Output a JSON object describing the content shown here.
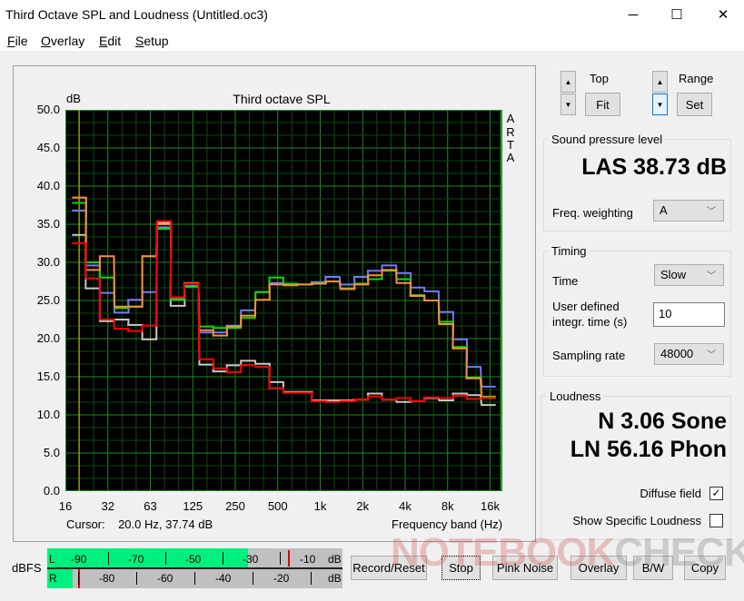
{
  "window": {
    "title": "Third Octave SPL and Loudness (Untitled.oc3)",
    "minimize": "─",
    "maximize": "☐",
    "close": "✕"
  },
  "menu": [
    {
      "first": "F",
      "rest": "ile"
    },
    {
      "first": "O",
      "rest": "verlay"
    },
    {
      "first": "E",
      "rest": "dit"
    },
    {
      "first": "S",
      "rest": "etup"
    }
  ],
  "chart_data": {
    "type": "line",
    "title": "Third octave SPL",
    "ylabel": "dB",
    "xlabel": "Frequency band (Hz)",
    "ylim": [
      0,
      50
    ],
    "yticks": [
      "50.0",
      "45.0",
      "40.0",
      "35.0",
      "30.0",
      "25.0",
      "20.0",
      "15.0",
      "10.0",
      "5.0",
      "0.0"
    ],
    "xticks": [
      "16",
      "32",
      "63",
      "125",
      "250",
      "500",
      "1k",
      "2k",
      "4k",
      "8k",
      "16k"
    ],
    "side_label": [
      "A",
      "R",
      "T",
      "A"
    ],
    "cursor_text": "Cursor:    20.0 Hz, 37.74 dB",
    "cursor_freq": 20,
    "bands_hz": [
      20,
      25,
      31.5,
      40,
      50,
      63,
      80,
      100,
      125,
      160,
      200,
      250,
      315,
      400,
      500,
      630,
      800,
      1000,
      1250,
      1600,
      2000,
      2500,
      3150,
      4000,
      5000,
      6300,
      8000,
      10000,
      12500,
      16000
    ],
    "series": [
      {
        "name": "gray",
        "color": "#c8c8c8",
        "values": [
          33.6,
          26.6,
          22.3,
          22.5,
          21.8,
          19.9,
          35.2,
          24.3,
          27.2,
          16.6,
          15.7,
          16.5,
          17.1,
          16.7,
          14.3,
          13.0,
          13.0,
          11.9,
          11.9,
          11.9,
          12.0,
          12.8,
          12.0,
          11.7,
          11.8,
          12.2,
          11.9,
          12.8,
          12.6,
          11.3
        ]
      },
      {
        "name": "blue",
        "color": "#7878ff",
        "values": [
          36.8,
          29.6,
          26.0,
          23.4,
          25.1,
          26.1,
          34.6,
          25.3,
          26.9,
          20.8,
          20.8,
          21.7,
          23.7,
          26.1,
          27.3,
          27.1,
          27.1,
          27.4,
          28.1,
          27.1,
          28.1,
          28.9,
          29.6,
          28.6,
          26.7,
          26.2,
          23.5,
          19.9,
          16.3,
          13.7
        ]
      },
      {
        "name": "green",
        "color": "#00e000",
        "values": [
          37.8,
          30.0,
          28.0,
          24.0,
          24.2,
          30.8,
          34.4,
          25.1,
          26.8,
          21.6,
          21.4,
          21.4,
          22.7,
          26.1,
          28.0,
          27.2,
          27.1,
          27.3,
          27.5,
          26.6,
          27.2,
          27.8,
          28.9,
          27.8,
          25.7,
          25.0,
          22.2,
          18.9,
          14.9,
          12.4
        ]
      },
      {
        "name": "orange",
        "color": "#ff8c3c",
        "values": [
          38.5,
          29.0,
          30.8,
          24.2,
          24.2,
          30.8,
          35.0,
          25.4,
          27.3,
          21.1,
          20.4,
          21.6,
          23.0,
          25.1,
          27.1,
          27.0,
          27.1,
          27.2,
          27.5,
          26.5,
          27.1,
          28.3,
          29.0,
          27.3,
          25.6,
          25.0,
          21.9,
          18.7,
          14.8,
          12.3
        ]
      },
      {
        "name": "red",
        "color": "#ff0000",
        "values": [
          32.5,
          27.9,
          22.5,
          21.3,
          21.0,
          21.7,
          35.4,
          25.4,
          27.2,
          17.3,
          16.1,
          15.6,
          16.5,
          16.3,
          13.5,
          12.9,
          12.9,
          11.8,
          11.7,
          11.8,
          12.0,
          12.4,
          12.0,
          12.2,
          11.8,
          12.3,
          12.2,
          12.5,
          12.1,
          12.2
        ]
      }
    ]
  },
  "controls": {
    "top_label": "Top",
    "range_label": "Range",
    "fit": "Fit",
    "set": "Set",
    "up": "▲",
    "down": "▼"
  },
  "spl": {
    "group": "Sound pressure level",
    "value": "LAS 38.73 dB",
    "weighting_label": "Freq. weighting",
    "weighting": "A"
  },
  "timing": {
    "group": "Timing",
    "time_label": "Time",
    "time": "Slow",
    "integ_label1": "User defined",
    "integ_label2": "integr. time (s)",
    "integ_value": "10",
    "rate_label": "Sampling rate",
    "rate": "48000"
  },
  "loudness": {
    "group": "Loudness",
    "n": "N 3.06 Sone",
    "ln": "LN 56.16 Phon",
    "diffuse_label": "Diffuse field",
    "diffuse_checked": true,
    "specific_label": "Show Specific Loudness",
    "specific_checked": false,
    "check": "✓"
  },
  "meter": {
    "label": "dBFS",
    "L": "L",
    "R": "R",
    "unit": "dB",
    "l_ticks": [
      "-90",
      "-70",
      "-50",
      "-30",
      "-10"
    ],
    "r_ticks": [
      "-80",
      "-60",
      "-40",
      "-20"
    ],
    "l_level_db": -31,
    "l_peak_db": -17,
    "r_level_db": -92,
    "r_peak_db": -90
  },
  "buttons": [
    "Record/Reset",
    "Stop",
    "Pink Noise",
    "Overlay",
    "B/W",
    "Copy"
  ],
  "watermark": {
    "a": "NOTEBOOK",
    "b": "CHECK"
  }
}
